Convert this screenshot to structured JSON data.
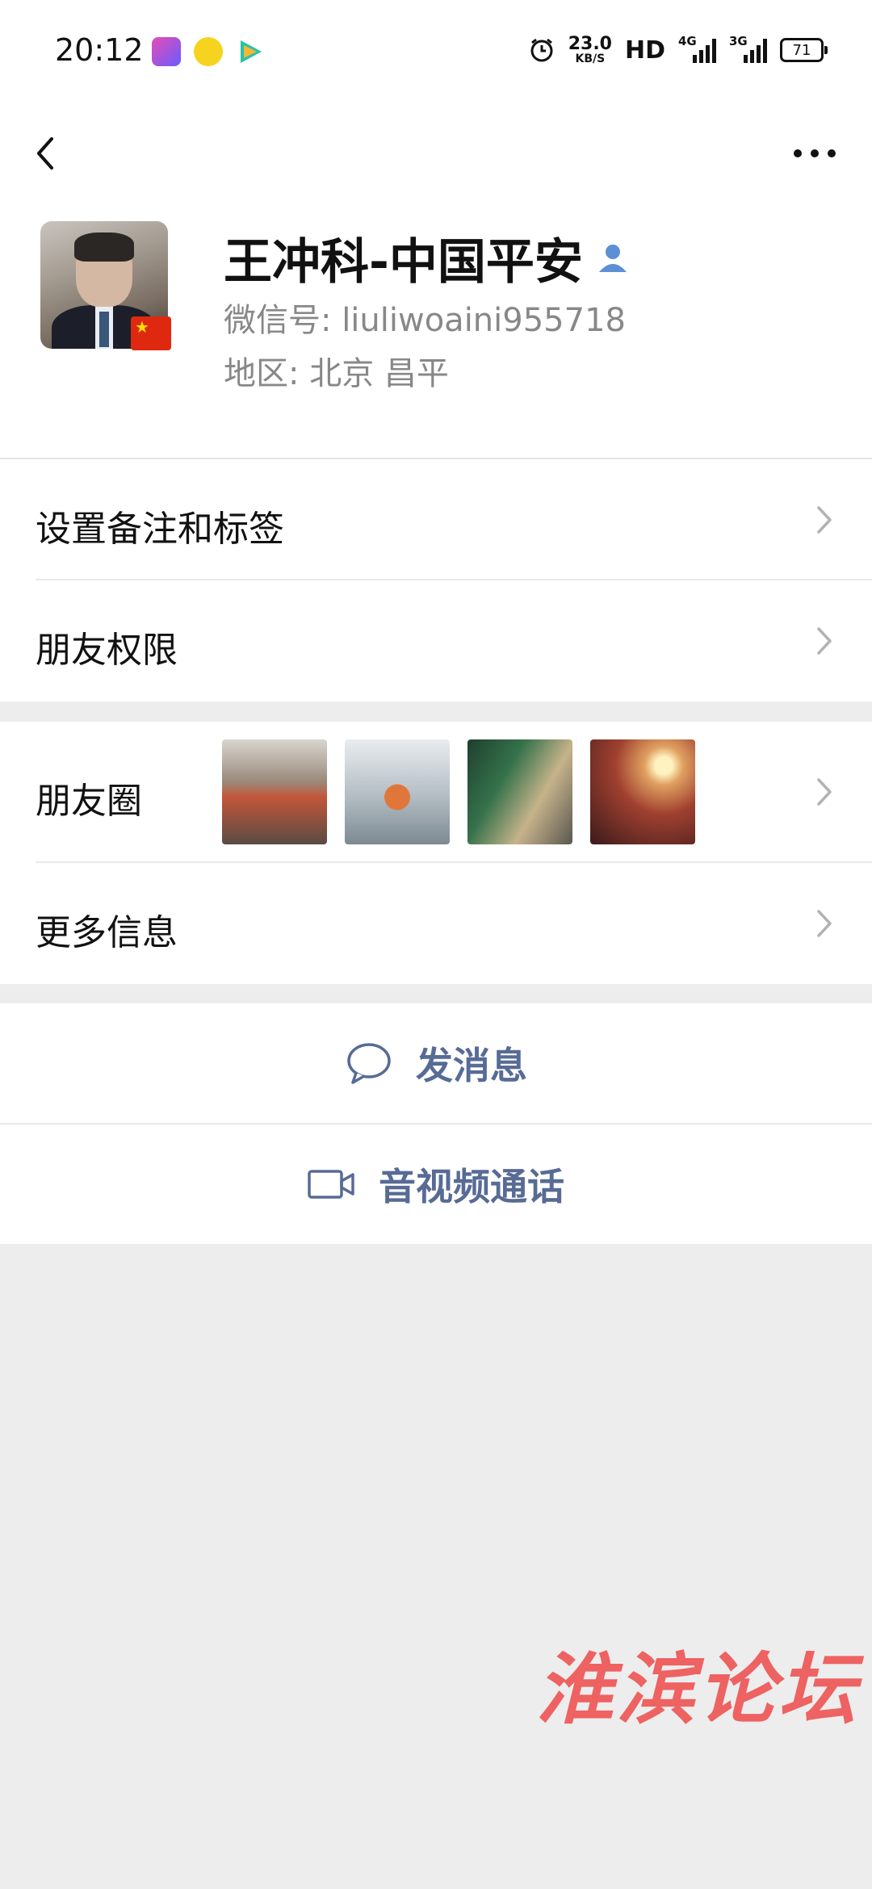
{
  "status_bar": {
    "time": "20:12",
    "net_speed_value": "23.0",
    "net_speed_unit": "KB/S",
    "hd_label": "HD",
    "signal1_label": "4G",
    "signal2_label": "3G",
    "battery": "71",
    "app_icons": [
      "editor-app-icon",
      "music-app-icon",
      "video-app-icon"
    ]
  },
  "nav": {
    "back_icon": "chevron-left-icon",
    "more_icon": "more-dots-icon"
  },
  "profile": {
    "name": "王冲科-中国平安",
    "wechat_id": "微信号: liuliwoaini955718",
    "region": "地区: 北京  昌平"
  },
  "menu": {
    "remark_tags": "设置备注和标签",
    "friend_permissions": "朋友权限",
    "moments": "朋友圈",
    "more_info": "更多信息"
  },
  "actions": {
    "send_message": "发消息",
    "av_call": "音视频通话"
  },
  "watermark": "淮滨论坛",
  "colors": {
    "accent_link": "#576b95",
    "background": "#ededed"
  }
}
